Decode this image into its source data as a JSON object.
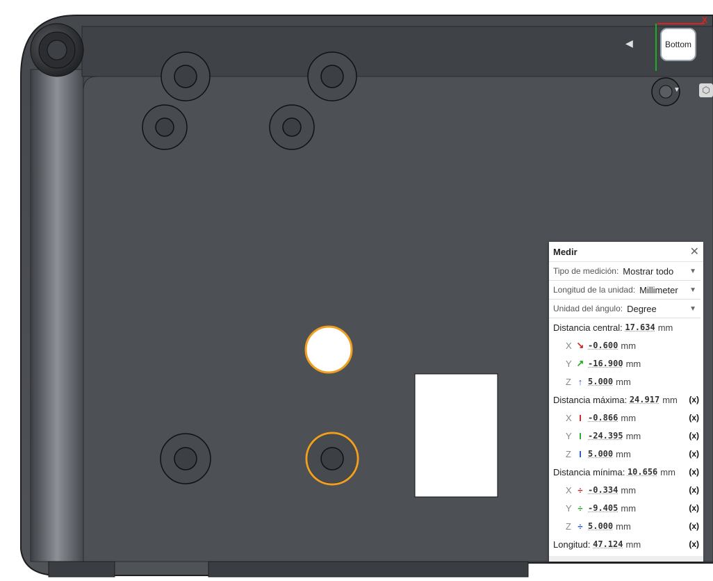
{
  "viewcube": {
    "face_label": "Bottom",
    "x_axis": "X",
    "arrow_left": "◀",
    "orbit_arrow": "▼",
    "home_icon": "⬡"
  },
  "measure": {
    "title": "Medir",
    "close_glyph": "✕",
    "type_label": "Tipo de medición:",
    "type_value": "Mostrar todo",
    "unit_len_label": "Longitud de la unidad:",
    "unit_len_value": "Millimeter",
    "unit_ang_label": "Unidad del ángulo:",
    "unit_ang_value": "Degree",
    "dropdown_glyph": "▼",
    "fx": "(x)",
    "center": {
      "label": "Distancia central:",
      "value": "17.634",
      "unit": "mm",
      "rows": [
        {
          "axis": "X",
          "icon": "↘",
          "color": "#cc2222",
          "value": "-0.600",
          "unit": "mm"
        },
        {
          "axis": "Y",
          "icon": "↗",
          "color": "#22aa22",
          "value": "-16.900",
          "unit": "mm"
        },
        {
          "axis": "Z",
          "icon": "↑",
          "color": "#2255cc",
          "value": "5.000",
          "unit": "mm"
        }
      ]
    },
    "max": {
      "label": "Distancia máxima:",
      "value": "24.917",
      "unit": "mm",
      "rows": [
        {
          "axis": "X",
          "icon": "I",
          "color": "#cc2222",
          "value": "-0.866",
          "unit": "mm"
        },
        {
          "axis": "Y",
          "icon": "I",
          "color": "#22aa22",
          "value": "-24.395",
          "unit": "mm"
        },
        {
          "axis": "Z",
          "icon": "I",
          "color": "#2255cc",
          "value": "5.000",
          "unit": "mm"
        }
      ]
    },
    "min": {
      "label": "Distancia mínima:",
      "value": "10.656",
      "unit": "mm",
      "rows": [
        {
          "axis": "X",
          "icon": "÷",
          "color": "#cc2222",
          "value": "-0.334",
          "unit": "mm"
        },
        {
          "axis": "Y",
          "icon": "÷",
          "color": "#22aa22",
          "value": "-9.405",
          "unit": "mm"
        },
        {
          "axis": "Z",
          "icon": "÷",
          "color": "#2255cc",
          "value": "5.000",
          "unit": "mm"
        }
      ]
    },
    "length": {
      "label": "Longitud:",
      "value": "47.124",
      "unit": "mm"
    }
  },
  "colors": {
    "model": "#4a4d52",
    "selection": "#f0a020"
  }
}
